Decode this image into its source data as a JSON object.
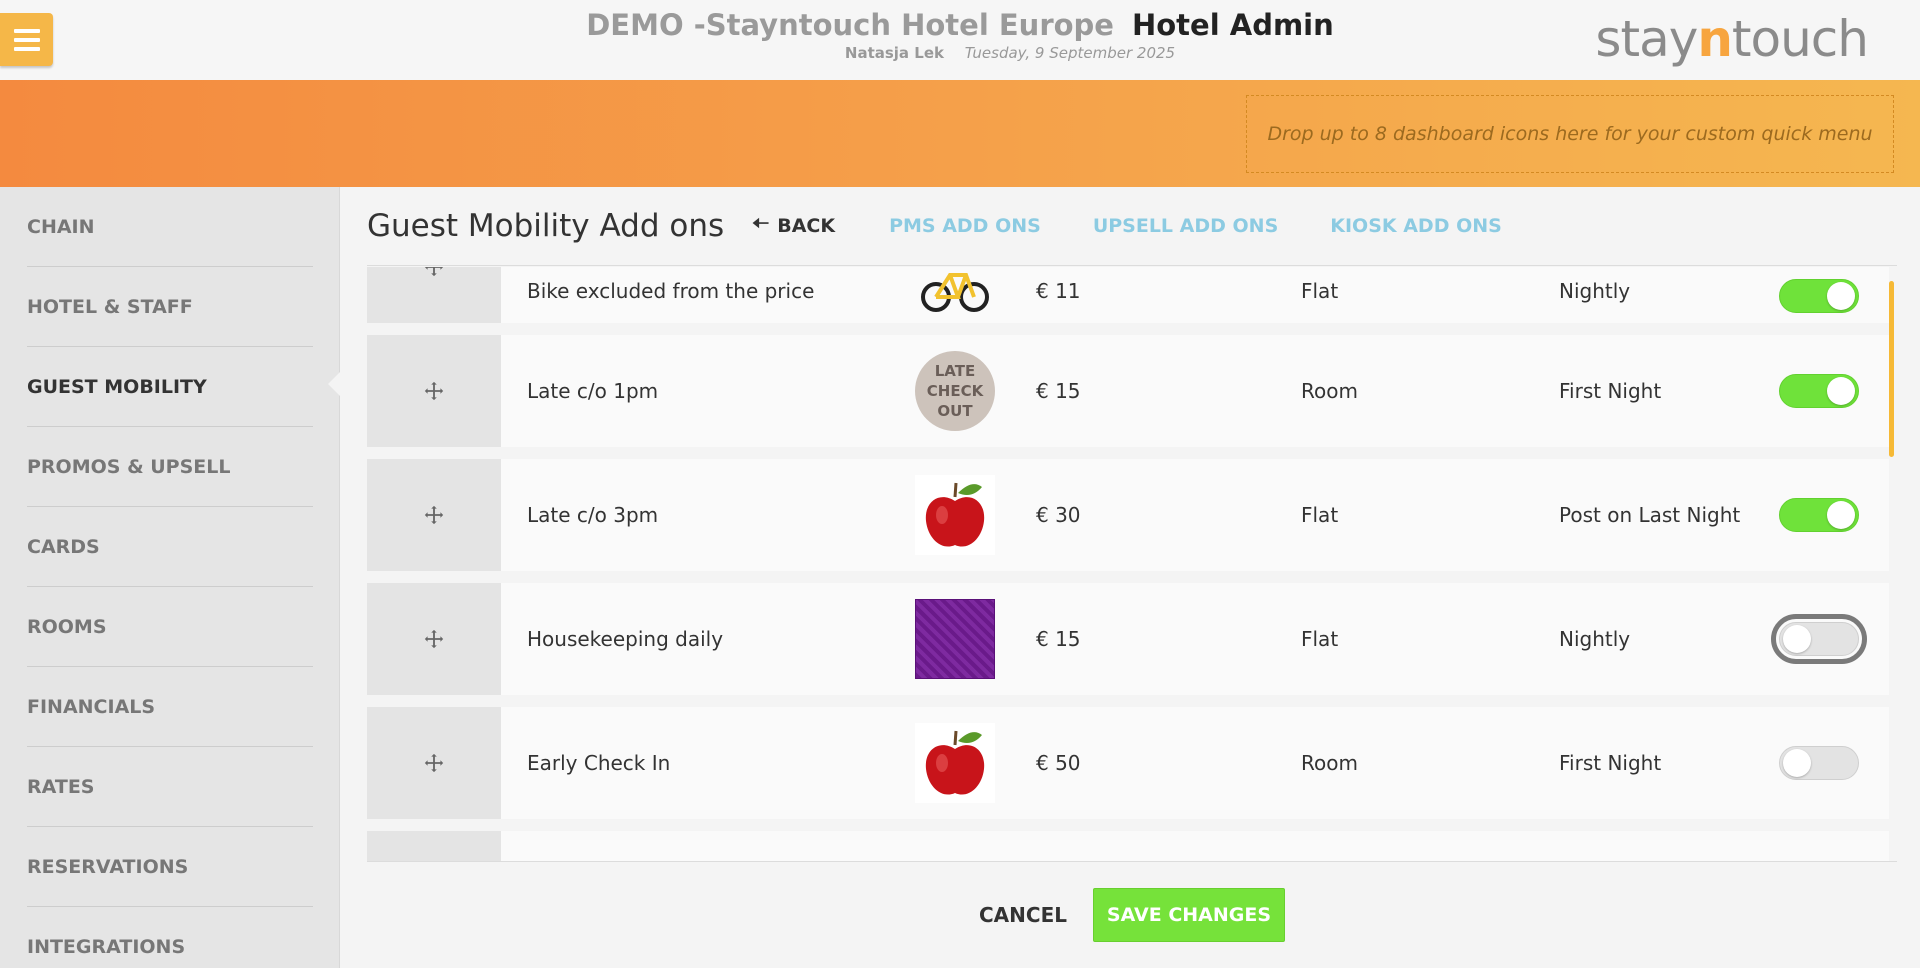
{
  "header": {
    "hotel_name": "DEMO -Stayntouch Hotel Europe",
    "app_name": "Hotel Admin",
    "user": "Natasja Lek",
    "date": "Tuesday, 9 September 2025",
    "logo_pre": "stay",
    "logo_n": "n",
    "logo_post": "touch"
  },
  "quick_menu": {
    "placeholder": "Drop up to 8 dashboard icons here for your custom quick menu"
  },
  "sidebar": {
    "items": [
      {
        "label": "CHAIN"
      },
      {
        "label": "HOTEL & STAFF"
      },
      {
        "label": "GUEST MOBILITY",
        "active": true
      },
      {
        "label": "PROMOS & UPSELL"
      },
      {
        "label": "CARDS"
      },
      {
        "label": "ROOMS"
      },
      {
        "label": "FINANCIALS"
      },
      {
        "label": "RATES"
      },
      {
        "label": "RESERVATIONS"
      },
      {
        "label": "INTEGRATIONS"
      }
    ]
  },
  "main": {
    "title": "Guest Mobility Add ons",
    "back_label": "BACK",
    "tabs": [
      {
        "label": "PMS ADD ONS"
      },
      {
        "label": "UPSELL ADD ONS"
      },
      {
        "label": "KIOSK ADD ONS"
      }
    ]
  },
  "addons": [
    {
      "name": "Bike excluded from the price",
      "image": "bicycle-image",
      "price": "€ 11",
      "type": "Flat",
      "frequency": "Nightly",
      "enabled": true
    },
    {
      "name": "Late c/o 1pm",
      "image": "late-checkout-image",
      "image_text": [
        "LATE",
        "CHECK",
        "OUT"
      ],
      "price": "€ 15",
      "type": "Room",
      "frequency": "First Night",
      "enabled": true
    },
    {
      "name": "Late c/o 3pm",
      "image": "apple-image",
      "price": "€ 30",
      "type": "Flat",
      "frequency": "Post on Last Night",
      "enabled": true
    },
    {
      "name": "Housekeeping daily",
      "image": "purple-textile-image",
      "price": "€ 15",
      "type": "Flat",
      "frequency": "Nightly",
      "enabled": false
    },
    {
      "name": "Early Check In",
      "image": "apple-image",
      "price": "€ 50",
      "type": "Room",
      "frequency": "First Night",
      "enabled": false
    }
  ],
  "footer": {
    "cancel_label": "CANCEL",
    "save_label": "SAVE CHANGES"
  },
  "colors": {
    "accent_orange": "#f5a04a",
    "toggle_on": "#6fe23a",
    "save_button": "#76e23a",
    "tab_link": "#8ccbe2"
  }
}
